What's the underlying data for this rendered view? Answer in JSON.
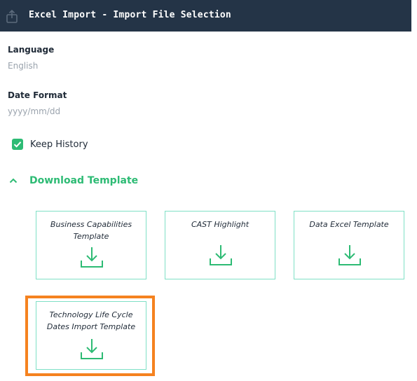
{
  "header": {
    "title": "Excel Import - Import File Selection",
    "icon": "export-icon"
  },
  "language": {
    "label": "Language",
    "value": "English"
  },
  "date_format": {
    "label": "Date Format",
    "value": "yyyy/mm/dd"
  },
  "keep_history": {
    "label": "Keep History",
    "checked": true
  },
  "download_template": {
    "label": "Download Template",
    "expanded": true,
    "templates": [
      {
        "label": "Business Capabilities Template"
      },
      {
        "label": "CAST Highlight"
      },
      {
        "label": "Data Excel Template"
      },
      {
        "label": "Technology Life Cycle Dates Import Template"
      }
    ]
  },
  "colors": {
    "header_bg": "#243447",
    "accent": "#2dbb74",
    "card_border": "#7fe0c6",
    "highlight": "#f5821f"
  }
}
